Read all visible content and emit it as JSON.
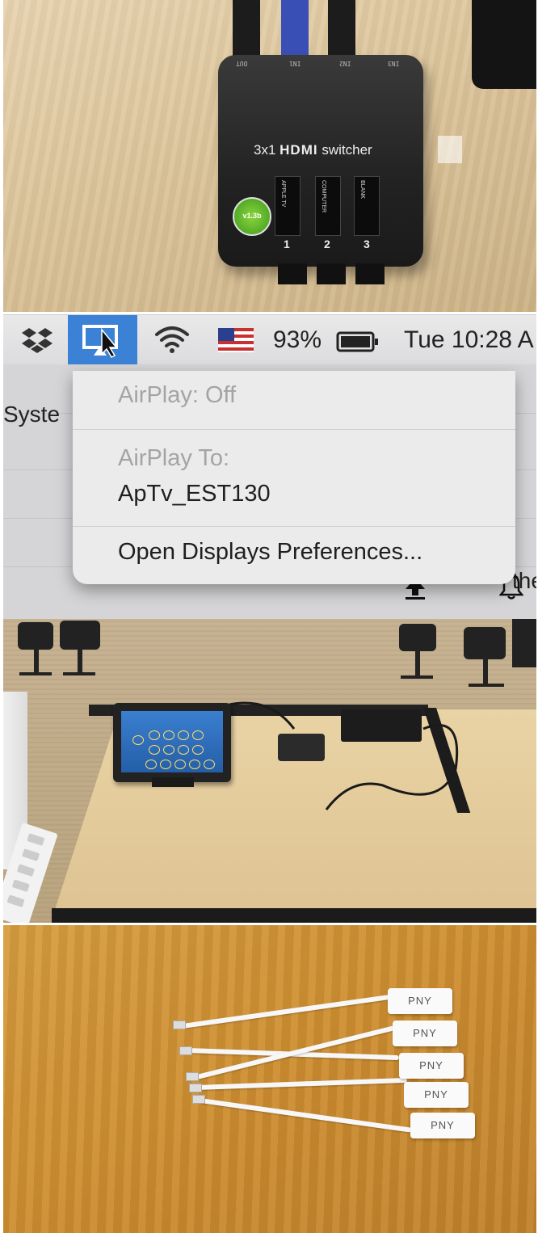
{
  "panel1": {
    "port_labels": [
      "OUT",
      "IN1",
      "IN2",
      "IN3"
    ],
    "switcher_title_prefix": "3x1",
    "switcher_title_brand": "HDMI",
    "switcher_title_suffix": "switcher",
    "badge_text": "v1.3b",
    "buttons": [
      {
        "label": "APPLE TV",
        "number": "1"
      },
      {
        "label": "COMPUTER",
        "number": "2"
      },
      {
        "label": "BLANK",
        "number": "3"
      }
    ]
  },
  "panel2": {
    "battery_percent": "93%",
    "clock": "Tue 10:28 A",
    "background_left_text": "Syste",
    "background_right_text": "the",
    "menu": {
      "airplay_status": "AirPlay: Off",
      "airplay_to_header": "AirPlay To:",
      "device": "ApTv_EST130",
      "open_prefs": "Open Displays Preferences..."
    },
    "icons": [
      "dropbox-icon",
      "airplay-icon",
      "wifi-icon",
      "us-flag-icon",
      "battery-icon",
      "upload-icon",
      "bell-icon"
    ]
  },
  "panel4": {
    "adapter_label": "PNY",
    "adapter_count": 5
  }
}
